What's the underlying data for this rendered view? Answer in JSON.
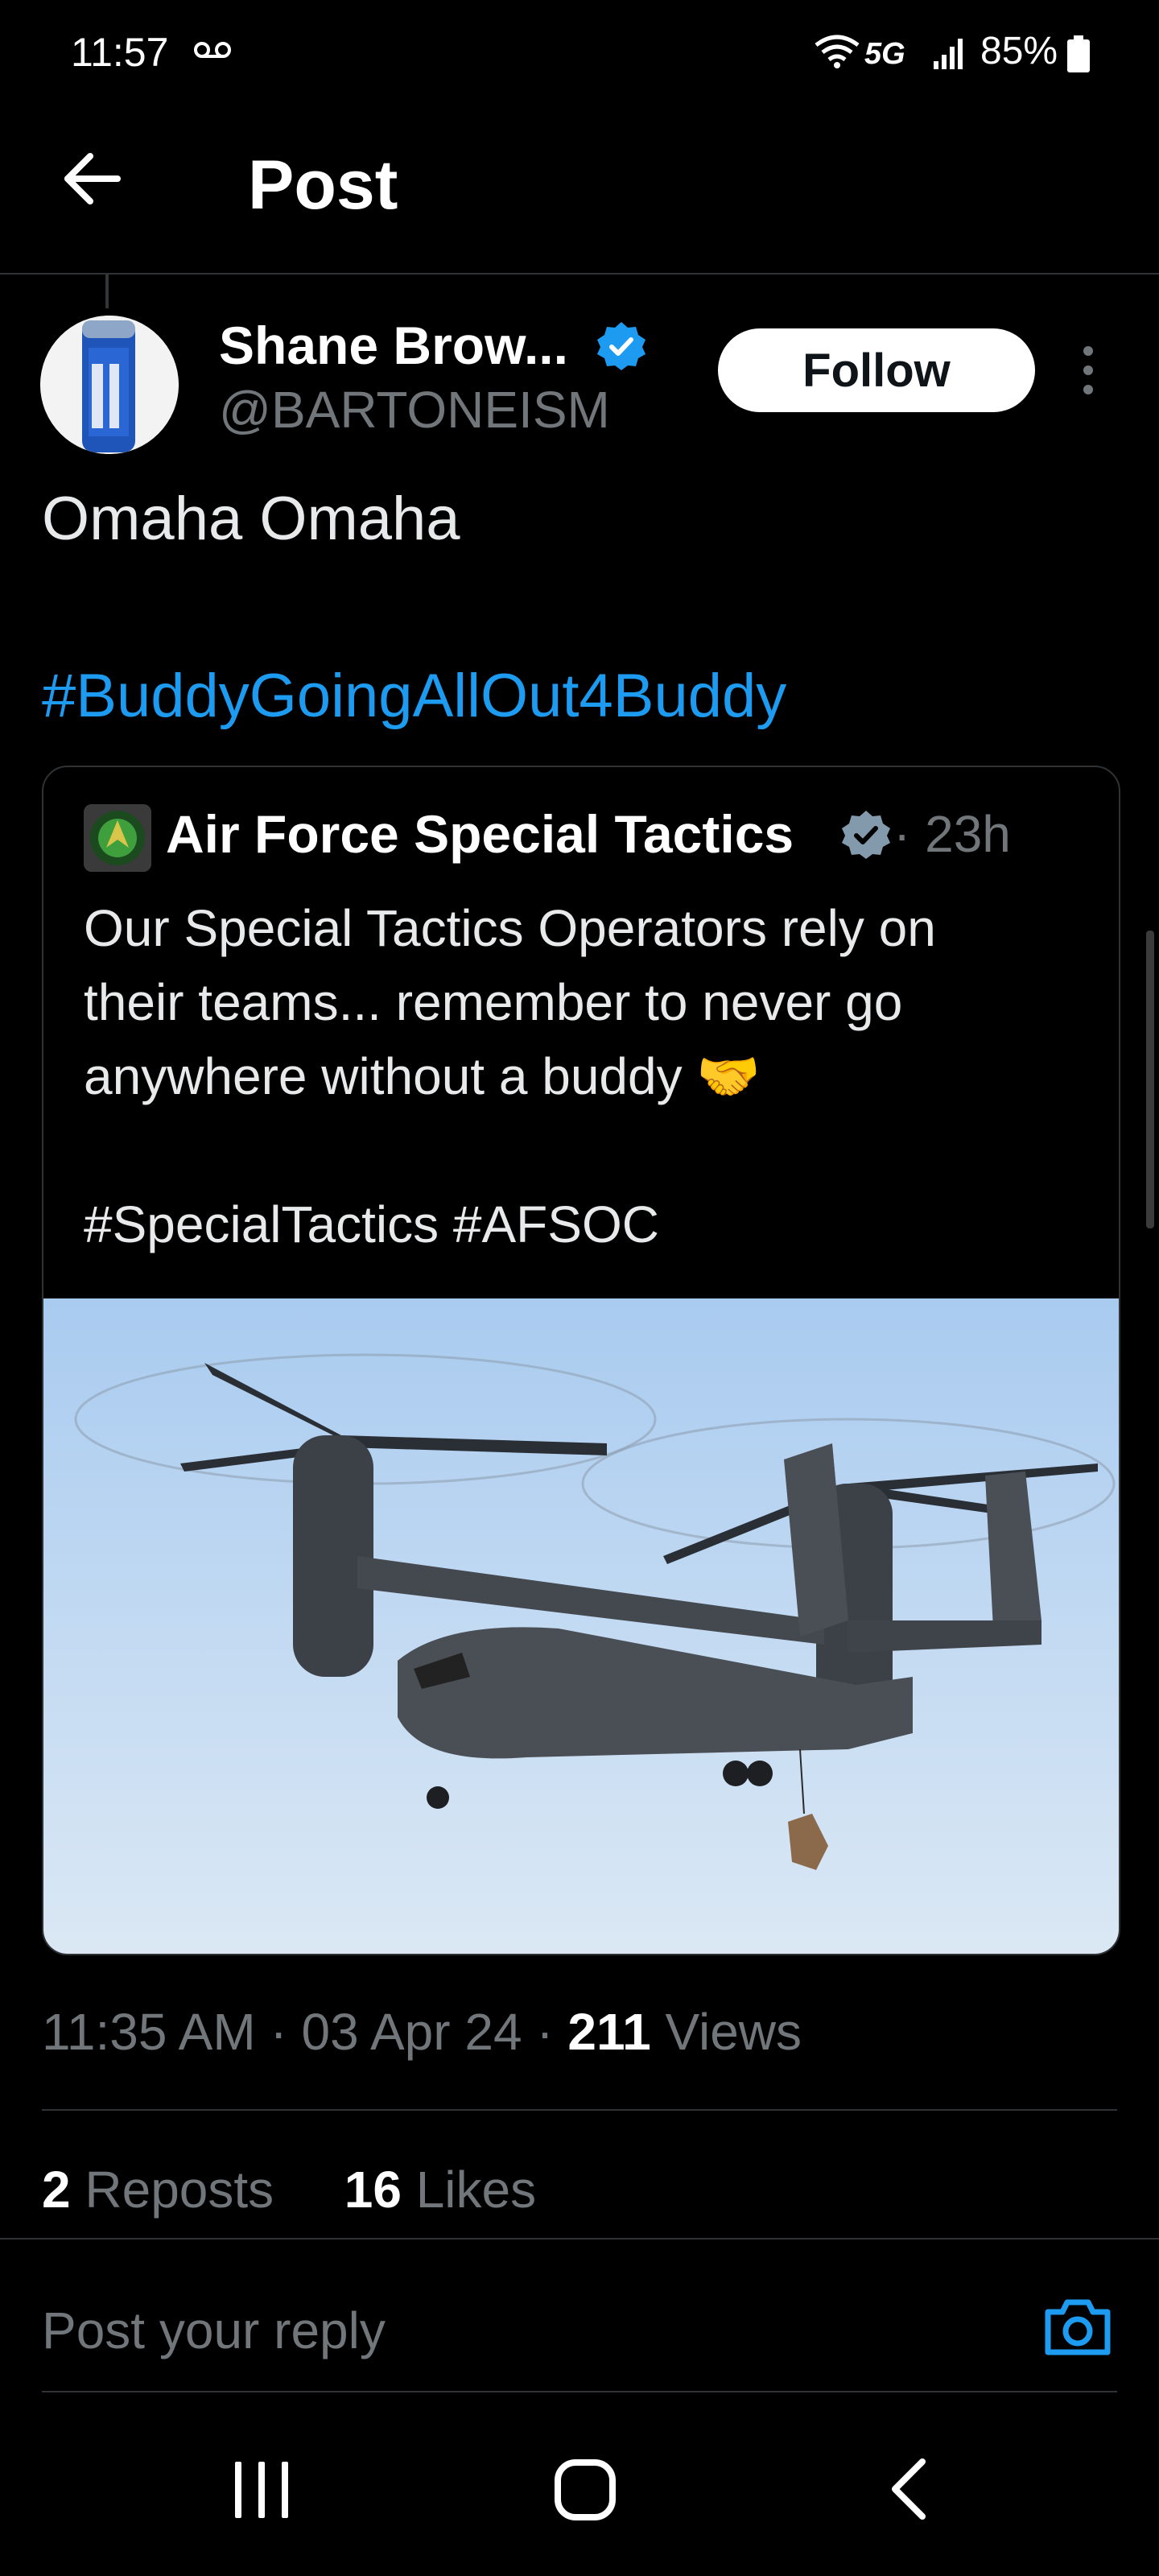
{
  "status_bar": {
    "time": "11:57",
    "network": "5G",
    "battery": "85%"
  },
  "header": {
    "title": "Post"
  },
  "post": {
    "author_name": "Shane Brow...",
    "author_handle": "@BARTONEISM",
    "follow_label": "Follow",
    "text": "Omaha Omaha",
    "hashtag": "#BuddyGoingAllOut4Buddy",
    "timestamp": "11:35 AM · 03 Apr 24 · ",
    "views_count": "211",
    "views_label": " Views",
    "reposts_count": "2",
    "reposts_label": " Reposts",
    "likes_count": "16",
    "likes_label": " Likes"
  },
  "quote": {
    "author_name": "Air Force Special Tactics",
    "time": "· 23h",
    "line1": "Our Special Tactics Operators rely on",
    "line2": "their teams... remember to never go",
    "line3": "anywhere without a buddy",
    "line4": "#SpecialTactics #AFSOC",
    "emoji": "🤝"
  },
  "reply": {
    "placeholder": "Post your reply"
  },
  "colors": {
    "accent": "#1d9bf0",
    "background": "#000000",
    "muted": "#71767b",
    "sky": "#b5d3f0"
  },
  "icons": [
    "voicemail-icon",
    "wifi-icon",
    "signal-icon",
    "battery-icon",
    "back-arrow-icon",
    "verified-icon",
    "more-icon",
    "camera-icon",
    "nav-recents-icon",
    "nav-home-icon",
    "nav-back-icon"
  ]
}
